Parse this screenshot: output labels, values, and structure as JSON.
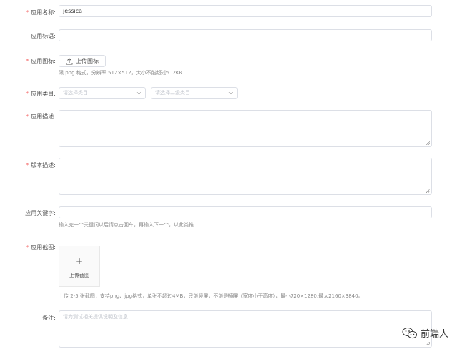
{
  "form": {
    "app_name": {
      "label": "应用名称:",
      "value": "jessica"
    },
    "app_slogan": {
      "label": "应用标语:"
    },
    "app_icon": {
      "label": "应用图标:",
      "button": "上传图标",
      "hint": "限 png 格式，分辨率 512×512，大小不能超过512KB"
    },
    "app_category": {
      "label": "应用类目:",
      "primary_placeholder": "请选择类目",
      "secondary_placeholder": "请选择二级类目"
    },
    "app_desc": {
      "label": "应用描述:"
    },
    "version_desc": {
      "label": "版本描述:"
    },
    "keywords": {
      "label": "应用关键字:",
      "hint": "输入完一个关键词以后请点击回车，再输入下一个，以此类推"
    },
    "screenshots": {
      "label": "应用截图:",
      "button": "上传截图",
      "hint": "上传 2-5 张截图，支持png、jpg格式，单张不超过4MB，只能竖屏，不能是横屏（宽度小于高度），最小720×1280,最大2160×3840。"
    },
    "remarks": {
      "label": "备注:",
      "placeholder": "请为测试相关提供说明及信息"
    }
  },
  "watermark": {
    "text": "前端人"
  },
  "colors": {
    "required": "#f56c6c",
    "border": "#dcdfe6"
  }
}
